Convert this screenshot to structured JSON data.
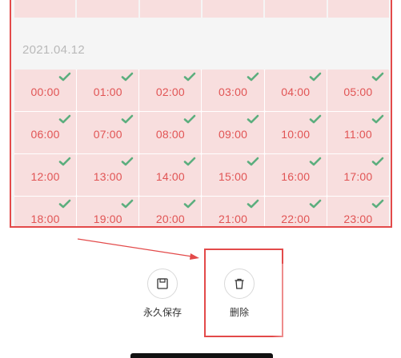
{
  "date": "2021.04.12",
  "slots": [
    "00:00",
    "01:00",
    "02:00",
    "03:00",
    "04:00",
    "05:00",
    "06:00",
    "07:00",
    "08:00",
    "09:00",
    "10:00",
    "11:00",
    "12:00",
    "13:00",
    "14:00",
    "15:00",
    "16:00",
    "17:00",
    "18:00",
    "19:00",
    "20:00",
    "21:00",
    "22:00",
    "23:00"
  ],
  "slot_state": "selected",
  "icons": {
    "check": "check-icon",
    "save": "save-icon",
    "delete": "trash-icon"
  },
  "actions": {
    "save_label": "永久保存",
    "delete_label": "删除"
  },
  "colors": {
    "slot_bg": "#f8dede",
    "slot_text": "#e15454",
    "check": "#5cae7e",
    "annotation": "#e34a4a"
  }
}
